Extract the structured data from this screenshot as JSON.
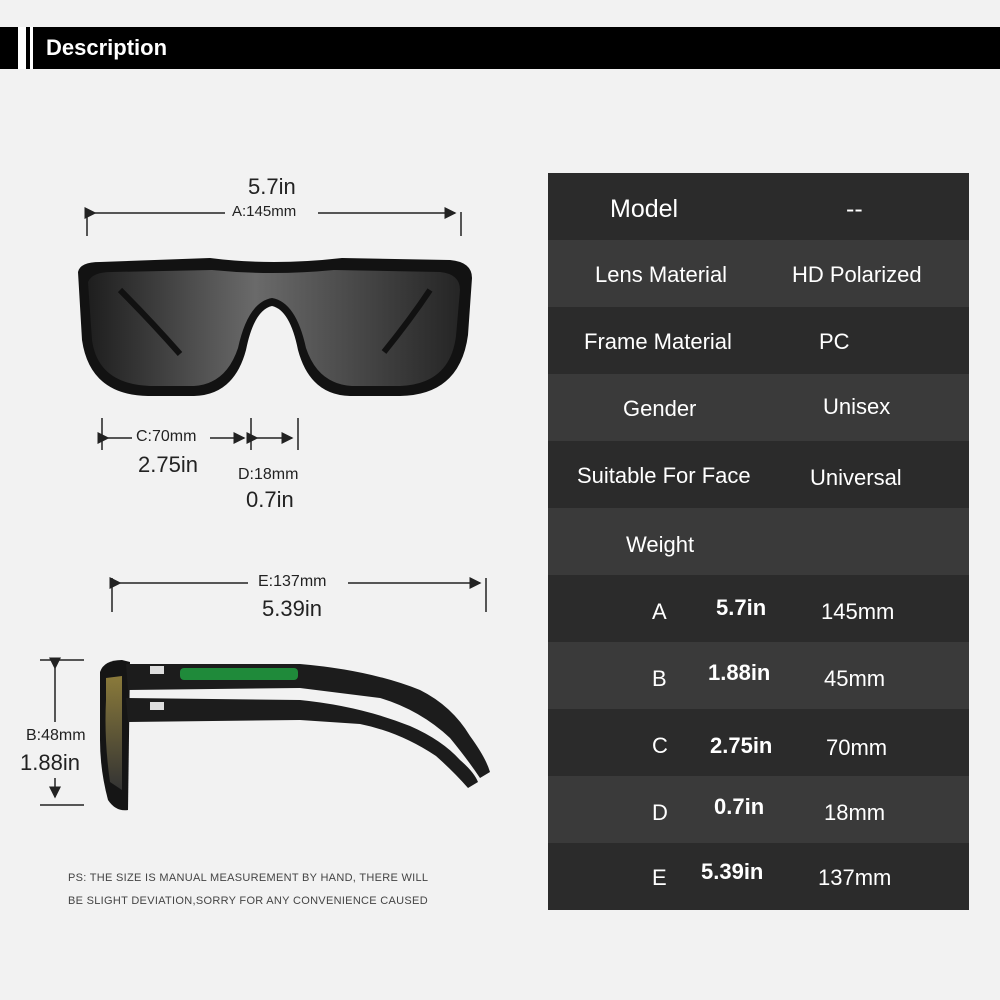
{
  "header": {
    "title": "Description"
  },
  "dimensions": {
    "a_in": "5.7in",
    "a_mm": "A:145mm",
    "c_mm": "C:70mm",
    "c_in": "2.75in",
    "d_mm": "D:18mm",
    "d_in": "0.7in",
    "e_mm": "E:137mm",
    "e_in": "5.39in",
    "b_mm": "B:48mm",
    "b_in": "1.88in"
  },
  "note": {
    "line1": "PS: THE SIZE IS MANUAL MEASUREMENT BY HAND, THERE WILL",
    "line2": "BE SLIGHT DEVIATION,SORRY FOR ANY CONVENIENCE CAUSED"
  },
  "specs": {
    "model_label": "Model",
    "model_value": "--",
    "lens_label": "Lens Material",
    "lens_value": "HD Polarized",
    "frame_label": "Frame Material",
    "frame_value": "PC",
    "gender_label": "Gender",
    "gender_value": "Unisex",
    "face_label": "Suitable For Face",
    "face_value": "Universal",
    "weight_label": "Weight"
  },
  "measure_rows": [
    {
      "letter": "A",
      "inch": "5.7in",
      "mm": "145mm"
    },
    {
      "letter": "B",
      "inch": "1.88in",
      "mm": "45mm"
    },
    {
      "letter": "C",
      "inch": "2.75in",
      "mm": "70mm"
    },
    {
      "letter": "D",
      "inch": "0.7in",
      "mm": "18mm"
    },
    {
      "letter": "E",
      "inch": "5.39in",
      "mm": "137mm"
    }
  ],
  "colors": {
    "table_dark": "#2b2b2b",
    "table_light": "#3a3a3a",
    "accent_green": "#1f8a3a"
  },
  "icons": [
    "sunglasses-front-image",
    "sunglasses-side-image"
  ]
}
